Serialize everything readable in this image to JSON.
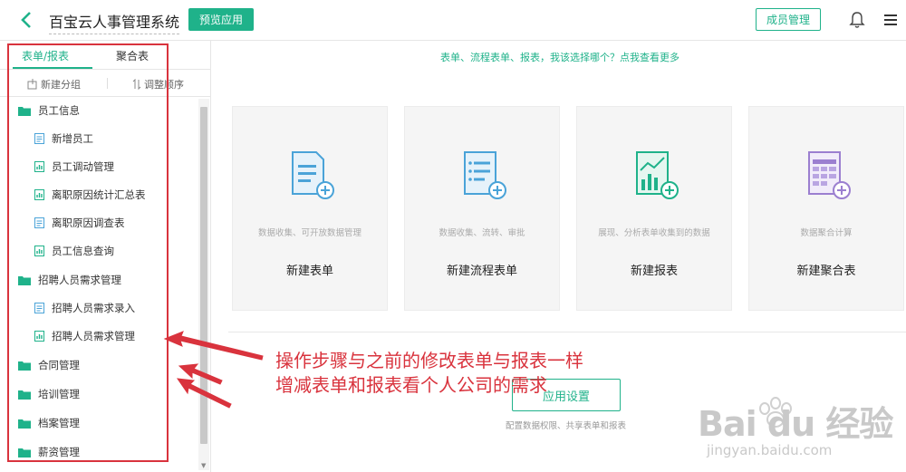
{
  "header": {
    "app_title": "百宝云人事管理系统",
    "preview_label": "预览应用",
    "member_label": "成员管理"
  },
  "sidebar": {
    "tabs": [
      {
        "label": "表单/报表",
        "active": true
      },
      {
        "label": "聚合表",
        "active": false
      }
    ],
    "tools": {
      "new_group": "新建分组",
      "reorder": "调整顺序"
    },
    "tree": [
      {
        "type": "folder",
        "label": "员工信息"
      },
      {
        "type": "form",
        "label": "新增员工"
      },
      {
        "type": "report",
        "label": "员工调动管理"
      },
      {
        "type": "report",
        "label": "离职原因统计汇总表"
      },
      {
        "type": "form",
        "label": "离职原因调查表"
      },
      {
        "type": "report",
        "label": "员工信息查询"
      },
      {
        "type": "folder",
        "label": "招聘人员需求管理"
      },
      {
        "type": "form",
        "label": "招聘人员需求录入"
      },
      {
        "type": "report",
        "label": "招聘人员需求管理"
      },
      {
        "type": "folder",
        "label": "合同管理"
      },
      {
        "type": "folder",
        "label": "培训管理"
      },
      {
        "type": "folder",
        "label": "档案管理"
      },
      {
        "type": "folder",
        "label": "薪资管理"
      }
    ]
  },
  "main": {
    "hint": "表单、流程表单、报表，我该选择哪个？点我查看更多",
    "cards": [
      {
        "desc": "数据收集、可开放数据管理",
        "name": "新建表单",
        "icon": "form-add-icon",
        "color": "#4aa3d8"
      },
      {
        "desc": "数据收集、流转、审批",
        "name": "新建流程表单",
        "icon": "flow-form-add-icon",
        "color": "#4aa3d8"
      },
      {
        "desc": "展现、分析表单收集到的数据",
        "name": "新建报表",
        "icon": "report-add-icon",
        "color": "#1fb28a"
      },
      {
        "desc": "数据聚合计算",
        "name": "新建聚合表",
        "icon": "aggregate-add-icon",
        "color": "#9b7fd0"
      }
    ],
    "settings_label": "应用设置",
    "settings_desc": "配置数据权限、共享表单和报表"
  },
  "annotation": {
    "line1": "操作步骤与之前的修改表单与报表一样",
    "line2": "增减表单和报表看个人公司的需求"
  },
  "watermark": {
    "text": "Bai du 经验",
    "sub": "jingyan.baidu.com"
  },
  "colors": {
    "accent": "#1fb28a",
    "annotation": "#d9333d"
  }
}
